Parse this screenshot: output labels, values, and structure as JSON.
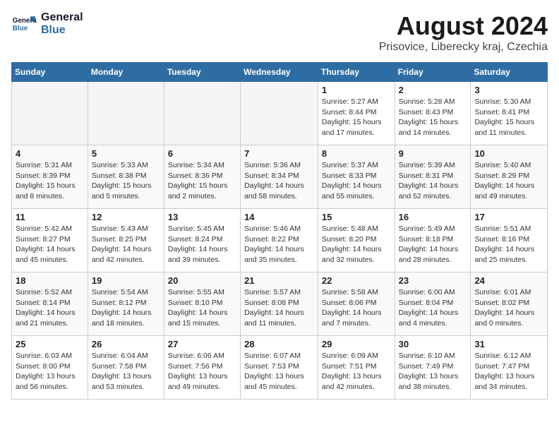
{
  "logo": {
    "name_line1": "General",
    "name_line2": "Blue"
  },
  "title": {
    "month_year": "August 2024",
    "location": "Prisovice, Liberecky kraj, Czechia"
  },
  "weekdays": [
    "Sunday",
    "Monday",
    "Tuesday",
    "Wednesday",
    "Thursday",
    "Friday",
    "Saturday"
  ],
  "weeks": [
    [
      {
        "day": "",
        "empty": true
      },
      {
        "day": "",
        "empty": true
      },
      {
        "day": "",
        "empty": true
      },
      {
        "day": "",
        "empty": true
      },
      {
        "day": "1",
        "sunrise": "5:27 AM",
        "sunset": "8:44 PM",
        "daylight": "15 hours and 17 minutes."
      },
      {
        "day": "2",
        "sunrise": "5:28 AM",
        "sunset": "8:43 PM",
        "daylight": "15 hours and 14 minutes."
      },
      {
        "day": "3",
        "sunrise": "5:30 AM",
        "sunset": "8:41 PM",
        "daylight": "15 hours and 11 minutes."
      }
    ],
    [
      {
        "day": "4",
        "sunrise": "5:31 AM",
        "sunset": "8:39 PM",
        "daylight": "15 hours and 8 minutes."
      },
      {
        "day": "5",
        "sunrise": "5:33 AM",
        "sunset": "8:38 PM",
        "daylight": "15 hours and 5 minutes."
      },
      {
        "day": "6",
        "sunrise": "5:34 AM",
        "sunset": "8:36 PM",
        "daylight": "15 hours and 2 minutes."
      },
      {
        "day": "7",
        "sunrise": "5:36 AM",
        "sunset": "8:34 PM",
        "daylight": "14 hours and 58 minutes."
      },
      {
        "day": "8",
        "sunrise": "5:37 AM",
        "sunset": "8:33 PM",
        "daylight": "14 hours and 55 minutes."
      },
      {
        "day": "9",
        "sunrise": "5:39 AM",
        "sunset": "8:31 PM",
        "daylight": "14 hours and 52 minutes."
      },
      {
        "day": "10",
        "sunrise": "5:40 AM",
        "sunset": "8:29 PM",
        "daylight": "14 hours and 49 minutes."
      }
    ],
    [
      {
        "day": "11",
        "sunrise": "5:42 AM",
        "sunset": "8:27 PM",
        "daylight": "14 hours and 45 minutes."
      },
      {
        "day": "12",
        "sunrise": "5:43 AM",
        "sunset": "8:25 PM",
        "daylight": "14 hours and 42 minutes."
      },
      {
        "day": "13",
        "sunrise": "5:45 AM",
        "sunset": "8:24 PM",
        "daylight": "14 hours and 39 minutes."
      },
      {
        "day": "14",
        "sunrise": "5:46 AM",
        "sunset": "8:22 PM",
        "daylight": "14 hours and 35 minutes."
      },
      {
        "day": "15",
        "sunrise": "5:48 AM",
        "sunset": "8:20 PM",
        "daylight": "14 hours and 32 minutes."
      },
      {
        "day": "16",
        "sunrise": "5:49 AM",
        "sunset": "8:18 PM",
        "daylight": "14 hours and 28 minutes."
      },
      {
        "day": "17",
        "sunrise": "5:51 AM",
        "sunset": "8:16 PM",
        "daylight": "14 hours and 25 minutes."
      }
    ],
    [
      {
        "day": "18",
        "sunrise": "5:52 AM",
        "sunset": "8:14 PM",
        "daylight": "14 hours and 21 minutes."
      },
      {
        "day": "19",
        "sunrise": "5:54 AM",
        "sunset": "8:12 PM",
        "daylight": "14 hours and 18 minutes."
      },
      {
        "day": "20",
        "sunrise": "5:55 AM",
        "sunset": "8:10 PM",
        "daylight": "14 hours and 15 minutes."
      },
      {
        "day": "21",
        "sunrise": "5:57 AM",
        "sunset": "8:08 PM",
        "daylight": "14 hours and 11 minutes."
      },
      {
        "day": "22",
        "sunrise": "5:58 AM",
        "sunset": "8:06 PM",
        "daylight": "14 hours and 7 minutes."
      },
      {
        "day": "23",
        "sunrise": "6:00 AM",
        "sunset": "8:04 PM",
        "daylight": "14 hours and 4 minutes."
      },
      {
        "day": "24",
        "sunrise": "6:01 AM",
        "sunset": "8:02 PM",
        "daylight": "14 hours and 0 minutes."
      }
    ],
    [
      {
        "day": "25",
        "sunrise": "6:03 AM",
        "sunset": "8:00 PM",
        "daylight": "13 hours and 56 minutes."
      },
      {
        "day": "26",
        "sunrise": "6:04 AM",
        "sunset": "7:58 PM",
        "daylight": "13 hours and 53 minutes."
      },
      {
        "day": "27",
        "sunrise": "6:06 AM",
        "sunset": "7:56 PM",
        "daylight": "13 hours and 49 minutes."
      },
      {
        "day": "28",
        "sunrise": "6:07 AM",
        "sunset": "7:53 PM",
        "daylight": "13 hours and 45 minutes."
      },
      {
        "day": "29",
        "sunrise": "6:09 AM",
        "sunset": "7:51 PM",
        "daylight": "13 hours and 42 minutes."
      },
      {
        "day": "30",
        "sunrise": "6:10 AM",
        "sunset": "7:49 PM",
        "daylight": "13 hours and 38 minutes."
      },
      {
        "day": "31",
        "sunrise": "6:12 AM",
        "sunset": "7:47 PM",
        "daylight": "13 hours and 34 minutes."
      }
    ]
  ]
}
